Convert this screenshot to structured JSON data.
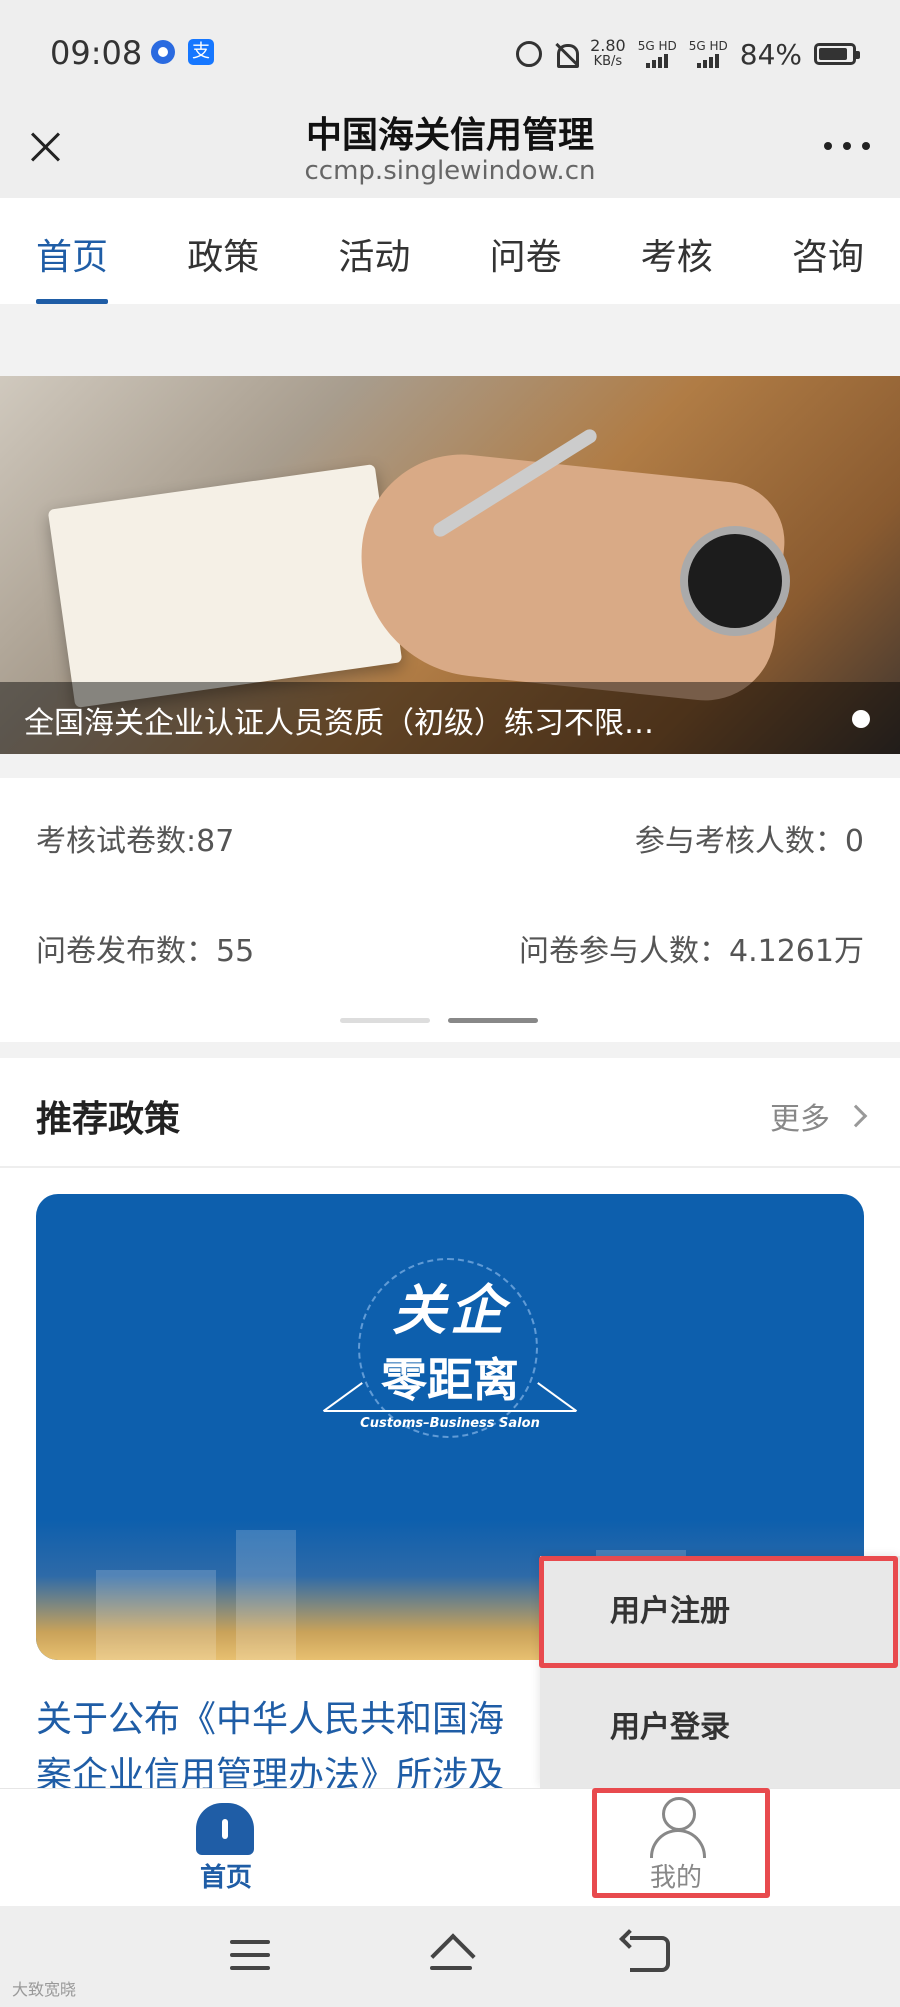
{
  "status_bar": {
    "time": "09:08",
    "speed_value": "2.80",
    "speed_unit": "KB/s",
    "net1": "5G HD",
    "net2": "5G HD",
    "battery": "84%",
    "app2_glyph": "支"
  },
  "title_bar": {
    "title": "中国海关信用管理",
    "url": "ccmp.singlewindow.cn"
  },
  "tabs": [
    {
      "label": "首页",
      "active": true
    },
    {
      "label": "政策",
      "active": false
    },
    {
      "label": "活动",
      "active": false
    },
    {
      "label": "问卷",
      "active": false
    },
    {
      "label": "考核",
      "active": false
    },
    {
      "label": "咨询",
      "active": false
    }
  ],
  "banner": {
    "caption": "全国海关企业认证人员资质（初级）练习不限…"
  },
  "stats": {
    "exam_papers": "考核试卷数:87",
    "exam_participants": "参与考核人数：0",
    "survey_published": "问卷发布数：55",
    "survey_participants": "问卷参与人数：4.1261万"
  },
  "policy": {
    "title": "推荐政策",
    "more": "更多",
    "card_logo_main": "关企",
    "card_logo_sub": "零距离",
    "card_logo_en": "Customs–Business Salon",
    "article_line1": "关于公布《中华人民共和国海",
    "article_line2": "案企业信用管理办法》所涉及"
  },
  "popup": {
    "register": "用户注册",
    "login": "用户登录"
  },
  "bottom_nav": {
    "home": "首页",
    "me": "我的"
  },
  "watermark": "大致宽晓",
  "colors": {
    "accent": "#1f5da6",
    "highlight": "#e84a4e",
    "card_bg": "#0d5fad"
  }
}
